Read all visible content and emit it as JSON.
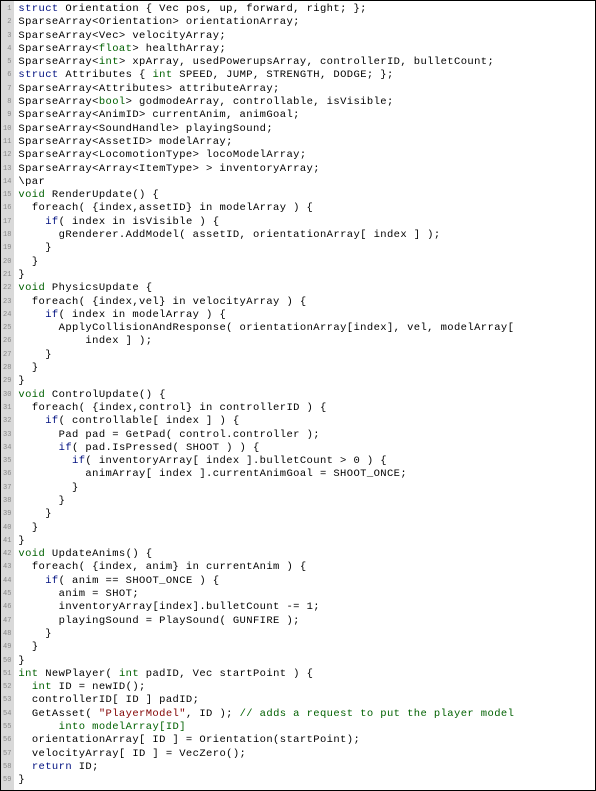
{
  "line_count": 57,
  "code_lines": [
    {
      "ind": 0,
      "tokens": [
        {
          "t": "struct",
          "c": "kw"
        },
        {
          "t": " Orientation { Vec pos, up, forward, right; };"
        }
      ]
    },
    {
      "ind": 0,
      "tokens": [
        {
          "t": "SparseArray<Orientation> orientationArray;"
        }
      ]
    },
    {
      "ind": 0,
      "tokens": [
        {
          "t": "SparseArray<Vec> velocityArray;"
        }
      ]
    },
    {
      "ind": 0,
      "tokens": [
        {
          "t": "SparseArray<"
        },
        {
          "t": "float",
          "c": "ty"
        },
        {
          "t": "> healthArray;"
        }
      ]
    },
    {
      "ind": 0,
      "tokens": [
        {
          "t": "SparseArray<"
        },
        {
          "t": "int",
          "c": "ty"
        },
        {
          "t": "> xpArray, usedPowerupsArray, controllerID, bulletCount;"
        }
      ]
    },
    {
      "ind": 0,
      "tokens": [
        {
          "t": "struct",
          "c": "kw"
        },
        {
          "t": " Attributes { "
        },
        {
          "t": "int",
          "c": "ty"
        },
        {
          "t": " SPEED, JUMP, STRENGTH, DODGE; };"
        }
      ]
    },
    {
      "ind": 0,
      "tokens": [
        {
          "t": "SparseArray<Attributes> attributeArray;"
        }
      ]
    },
    {
      "ind": 0,
      "tokens": [
        {
          "t": "SparseArray<"
        },
        {
          "t": "bool",
          "c": "ty"
        },
        {
          "t": "> godmodeArray, controllable, isVisible;"
        }
      ]
    },
    {
      "ind": 0,
      "tokens": [
        {
          "t": "SparseArray<AnimID> currentAnim, animGoal;"
        }
      ]
    },
    {
      "ind": 0,
      "tokens": [
        {
          "t": "SparseArray<SoundHandle> playingSound;"
        }
      ]
    },
    {
      "ind": 0,
      "tokens": [
        {
          "t": "SparseArray<AssetID> modelArray;"
        }
      ]
    },
    {
      "ind": 0,
      "tokens": [
        {
          "t": "SparseArray<LocomotionType> locoModelArray;"
        }
      ]
    },
    {
      "ind": 0,
      "tokens": [
        {
          "t": "SparseArray<Array<ItemType> > inventoryArray;"
        }
      ]
    },
    {
      "ind": 0,
      "tokens": [
        {
          "t": "\\par"
        }
      ]
    },
    {
      "ind": 0,
      "tokens": [
        {
          "t": "void",
          "c": "ty"
        },
        {
          "t": " RenderUpdate() {"
        }
      ]
    },
    {
      "ind": 1,
      "tokens": [
        {
          "t": "foreach( {index,assetID} in modelArray ) {"
        }
      ]
    },
    {
      "ind": 2,
      "tokens": [
        {
          "t": "if",
          "c": "kw"
        },
        {
          "t": "( index in isVisible ) {"
        }
      ]
    },
    {
      "ind": 3,
      "tokens": [
        {
          "t": "gRenderer.AddModel( assetID, orientationArray[ index ] );"
        }
      ]
    },
    {
      "ind": 2,
      "tokens": [
        {
          "t": "}"
        }
      ]
    },
    {
      "ind": 1,
      "tokens": [
        {
          "t": "}"
        }
      ]
    },
    {
      "ind": 0,
      "tokens": [
        {
          "t": "}"
        }
      ]
    },
    {
      "ind": 0,
      "tokens": [
        {
          "t": "void",
          "c": "ty"
        },
        {
          "t": " PhysicsUpdate {"
        }
      ]
    },
    {
      "ind": 1,
      "tokens": [
        {
          "t": "foreach( {index,vel} in velocityArray ) {"
        }
      ]
    },
    {
      "ind": 2,
      "tokens": [
        {
          "t": "if",
          "c": "kw"
        },
        {
          "t": "( index in modelArray ) {"
        }
      ]
    },
    {
      "ind": 3,
      "tokens": [
        {
          "t": "ApplyCollisionAndResponse( orientationArray[index], vel, modelArray["
        }
      ]
    },
    {
      "ind": 5,
      "tokens": [
        {
          "t": "index ] );"
        }
      ]
    },
    {
      "ind": 2,
      "tokens": [
        {
          "t": "}"
        }
      ]
    },
    {
      "ind": 1,
      "tokens": [
        {
          "t": "}"
        }
      ]
    },
    {
      "ind": 0,
      "tokens": [
        {
          "t": "}"
        }
      ]
    },
    {
      "ind": 0,
      "tokens": [
        {
          "t": "void",
          "c": "ty"
        },
        {
          "t": " ControlUpdate() {"
        }
      ]
    },
    {
      "ind": 1,
      "tokens": [
        {
          "t": "foreach( {index,control} in controllerID ) {"
        }
      ]
    },
    {
      "ind": 2,
      "tokens": [
        {
          "t": "if",
          "c": "kw"
        },
        {
          "t": "( controllable[ index ] ) {"
        }
      ]
    },
    {
      "ind": 3,
      "tokens": [
        {
          "t": "Pad pad = GetPad( control.controller );"
        }
      ]
    },
    {
      "ind": 3,
      "tokens": [
        {
          "t": "if",
          "c": "kw"
        },
        {
          "t": "( pad.IsPressed( SHOOT ) ) {"
        }
      ]
    },
    {
      "ind": 4,
      "tokens": [
        {
          "t": "if",
          "c": "kw"
        },
        {
          "t": "( inventoryArray[ index ].bulletCount > 0 ) {"
        }
      ]
    },
    {
      "ind": 5,
      "tokens": [
        {
          "t": "animArray[ index ].currentAnimGoal = SHOOT_ONCE;"
        }
      ]
    },
    {
      "ind": 4,
      "tokens": [
        {
          "t": "}"
        }
      ]
    },
    {
      "ind": 3,
      "tokens": [
        {
          "t": "}"
        }
      ]
    },
    {
      "ind": 2,
      "tokens": [
        {
          "t": "}"
        }
      ]
    },
    {
      "ind": 1,
      "tokens": [
        {
          "t": "}"
        }
      ]
    },
    {
      "ind": 0,
      "tokens": [
        {
          "t": "}"
        }
      ]
    },
    {
      "ind": 0,
      "tokens": [
        {
          "t": "void",
          "c": "ty"
        },
        {
          "t": " UpdateAnims() {"
        }
      ]
    },
    {
      "ind": 1,
      "tokens": [
        {
          "t": "foreach( {index, anim} in currentAnim ) {"
        }
      ]
    },
    {
      "ind": 2,
      "tokens": [
        {
          "t": "if",
          "c": "kw"
        },
        {
          "t": "( anim == SHOOT_ONCE ) {"
        }
      ]
    },
    {
      "ind": 3,
      "tokens": [
        {
          "t": "anim = SHOT;"
        }
      ]
    },
    {
      "ind": 3,
      "tokens": [
        {
          "t": "inventoryArray[index].bulletCount -= 1;"
        }
      ]
    },
    {
      "ind": 3,
      "tokens": [
        {
          "t": "playingSound = PlaySound( GUNFIRE );"
        }
      ]
    },
    {
      "ind": 2,
      "tokens": [
        {
          "t": "}"
        }
      ]
    },
    {
      "ind": 1,
      "tokens": [
        {
          "t": "}"
        }
      ]
    },
    {
      "ind": 0,
      "tokens": [
        {
          "t": "}"
        }
      ]
    },
    {
      "ind": 0,
      "tokens": [
        {
          "t": "int",
          "c": "ty"
        },
        {
          "t": " NewPlayer( "
        },
        {
          "t": "int",
          "c": "ty"
        },
        {
          "t": " padID, Vec startPoint ) {"
        }
      ]
    },
    {
      "ind": 1,
      "tokens": [
        {
          "t": "int",
          "c": "ty"
        },
        {
          "t": " ID = newID();"
        }
      ]
    },
    {
      "ind": 1,
      "tokens": [
        {
          "t": "controllerID[ ID ] padID;"
        }
      ]
    },
    {
      "ind": 1,
      "tokens": [
        {
          "t": "GetAsset( "
        },
        {
          "t": "\"PlayerModel\"",
          "c": "st"
        },
        {
          "t": ", ID ); "
        },
        {
          "t": "// adds a request to put the player model",
          "c": "cm"
        }
      ]
    },
    {
      "ind": 3,
      "tokens": [
        {
          "t": "into modelArray[ID]",
          "c": "cm"
        }
      ]
    },
    {
      "ind": 1,
      "tokens": [
        {
          "t": "orientationArray[ ID ] = Orientation(startPoint);"
        }
      ]
    },
    {
      "ind": 1,
      "tokens": [
        {
          "t": "velocityArray[ ID ] = VecZero();"
        }
      ]
    },
    {
      "ind": 1,
      "tokens": [
        {
          "t": "return",
          "c": "kw"
        },
        {
          "t": " ID;"
        }
      ]
    },
    {
      "ind": 0,
      "tokens": [
        {
          "t": "}"
        }
      ]
    }
  ]
}
